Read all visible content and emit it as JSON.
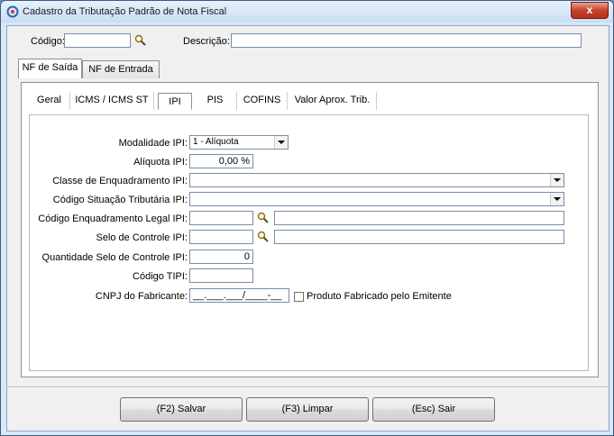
{
  "window": {
    "title": "Cadastro da Tributação Padrão de Nota Fiscal",
    "close_label": "x"
  },
  "header": {
    "codigo_label": "Código:",
    "codigo_value": "",
    "descricao_label": "Descrição:",
    "descricao_value": ""
  },
  "outer_tabs": [
    {
      "label": "NF de Saída",
      "active": true
    },
    {
      "label": "NF de Entrada",
      "active": false
    }
  ],
  "inner_tabs": [
    {
      "label": "Geral",
      "active": false
    },
    {
      "label": "ICMS / ICMS ST",
      "active": false
    },
    {
      "label": "IPI",
      "active": true
    },
    {
      "label": "PIS",
      "active": false
    },
    {
      "label": "COFINS",
      "active": false
    },
    {
      "label": "Valor Aprox. Trib.",
      "active": false
    }
  ],
  "ipi": {
    "modalidade_label": "Modalidade IPI:",
    "modalidade_value": "1 - Alíquota",
    "aliquota_label": "Alíquota IPI:",
    "aliquota_value": "0,00 %",
    "classe_label": "Classe de Enquadramento IPI:",
    "classe_value": "",
    "cst_label": "Código Situação Tributária IPI:",
    "cst_value": "",
    "enq_legal_label": "Código Enquadramento Legal IPI:",
    "enq_legal_value": "",
    "enq_legal_desc": "",
    "selo_label": "Selo de Controle IPI:",
    "selo_value": "",
    "selo_desc": "",
    "qtd_selo_label": "Quantidade Selo de Controle IPI:",
    "qtd_selo_value": "0",
    "tipi_label": "Código TIPI:",
    "tipi_value": "",
    "cnpj_label": "CNPJ do Fabricante:",
    "cnpj_value": "__.___.___/____-__",
    "produto_fabricado_label": "Produto Fabricado pelo Emitente",
    "produto_fabricado_checked": false
  },
  "buttons": {
    "salvar": "(F2) Salvar",
    "limpar": "(F3) Limpar",
    "sair": "(Esc) Sair"
  },
  "colors": {
    "accent": "#3a5b86",
    "close": "#c7402a"
  },
  "icons": {
    "search": "magnifier-icon",
    "app": "app-logo-icon"
  }
}
